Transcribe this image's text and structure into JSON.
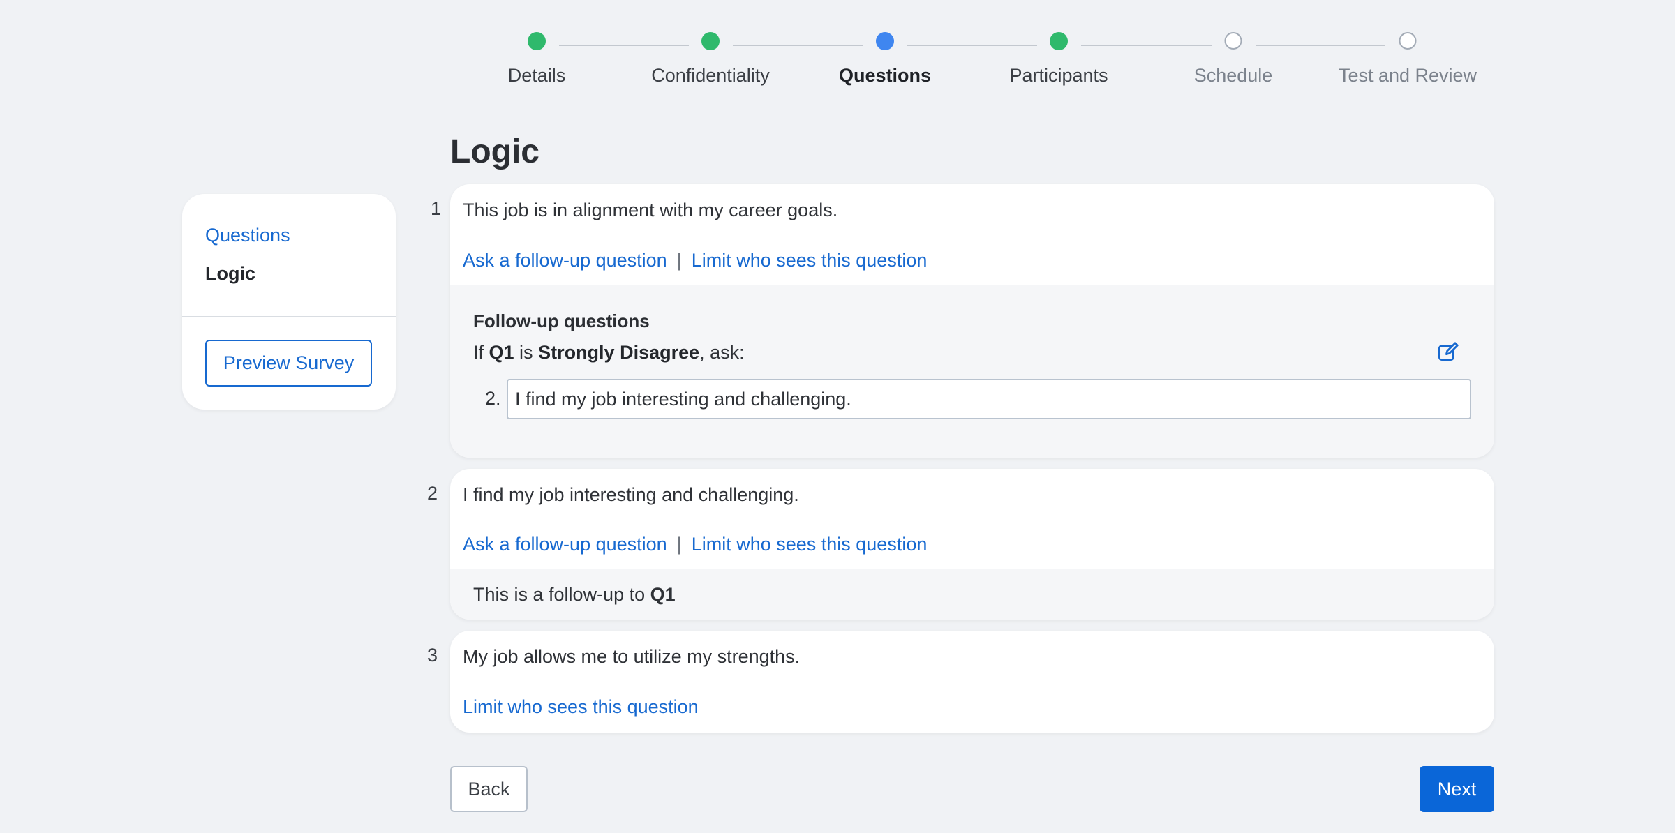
{
  "stepper": {
    "steps": [
      {
        "label": "Details",
        "state": "done"
      },
      {
        "label": "Confidentiality",
        "state": "done"
      },
      {
        "label": "Questions",
        "state": "current"
      },
      {
        "label": "Participants",
        "state": "done"
      },
      {
        "label": "Schedule",
        "state": "todo"
      },
      {
        "label": "Test and Review",
        "state": "todo"
      }
    ]
  },
  "sidebar": {
    "questions_link": "Questions",
    "logic_link": "Logic",
    "preview_button": "Preview Survey"
  },
  "main": {
    "title": "Logic",
    "questions": [
      {
        "number": "1",
        "text": "This job is in alignment with my career goals.",
        "follow_up_link": "Ask a follow-up question",
        "separator": "|",
        "limit_link": "Limit who sees this question",
        "followup_panel": {
          "heading": "Follow-up questions",
          "rule_prefix": "If ",
          "rule_question": "Q1",
          "rule_middle": " is ",
          "rule_answer": "Strongly Disagree",
          "rule_suffix": ", ask:",
          "item_number": "2.",
          "item_value": "I find my job interesting and challenging."
        }
      },
      {
        "number": "2",
        "text": "I find my job interesting and challenging.",
        "follow_up_link": "Ask a follow-up question",
        "separator": "|",
        "limit_link": "Limit who sees this question",
        "note_prefix": "This is a follow-up to ",
        "note_question": "Q1"
      },
      {
        "number": "3",
        "text": "My job allows me to utilize my strengths.",
        "limit_link": "Limit who sees this question"
      }
    ]
  },
  "footer": {
    "back_button": "Back",
    "next_button": "Next"
  },
  "colors": {
    "done": "#2fb96c",
    "current": "#3f86f0",
    "link": "#1769d0",
    "primary_button": "#0a66d8"
  },
  "icons": {
    "edit": "edit-icon"
  }
}
